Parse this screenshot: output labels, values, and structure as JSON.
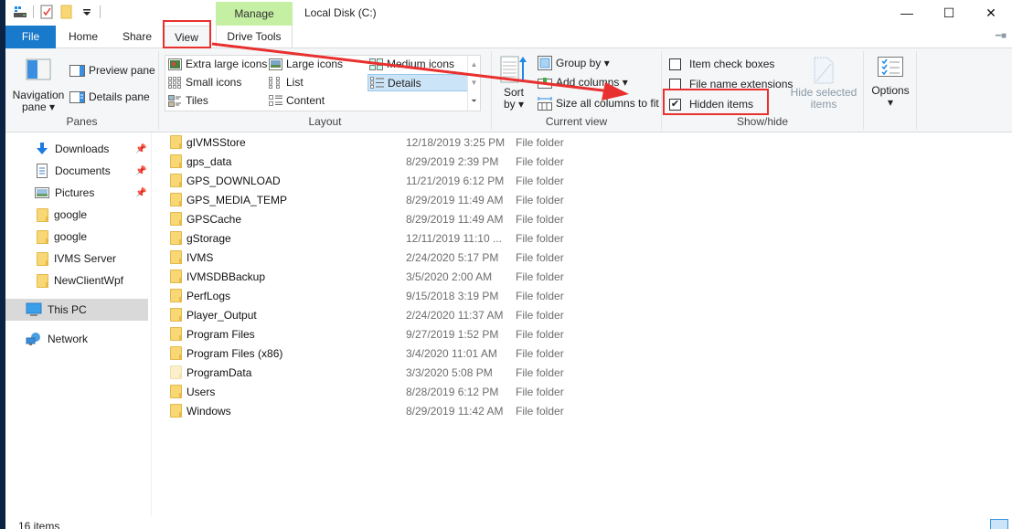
{
  "window": {
    "title": "Local Disk (C:)",
    "context_tab": "Manage",
    "minimize": "—",
    "maximize": "☐",
    "close": "✕"
  },
  "tabs": {
    "file": "File",
    "home": "Home",
    "share": "Share",
    "view": "View",
    "drive_tools": "Drive Tools"
  },
  "ribbon": {
    "panes": {
      "label": "Panes",
      "navigation_pane": "Navigation",
      "navigation_pane_2": "pane ▾",
      "preview_pane": "Preview pane",
      "details_pane": "Details pane"
    },
    "layout": {
      "label": "Layout",
      "items": [
        "Extra large icons",
        "Large icons",
        "Medium icons",
        "Small icons",
        "List",
        "Details",
        "Tiles",
        "Content"
      ],
      "selected": "Details"
    },
    "current_view": {
      "label": "Current view",
      "sort_by": "Sort",
      "sort_by_2": "by ▾",
      "group_by": "Group by ▾",
      "add_columns": "Add columns ▾",
      "size_columns": "Size all columns to fit"
    },
    "show_hide": {
      "label": "Show/hide",
      "item_check_boxes": "Item check boxes",
      "item_check_boxes_checked": false,
      "file_name_extensions": "File name extensions",
      "file_name_extensions_checked": false,
      "hidden_items": "Hidden items",
      "hidden_items_checked": true,
      "hide_selected": "Hide selected",
      "hide_selected_2": "items"
    },
    "options": {
      "label": "Options",
      "caret": "▾"
    }
  },
  "nav": {
    "items": [
      {
        "label": "Downloads",
        "icon": "download-icon",
        "pinned": true
      },
      {
        "label": "Documents",
        "icon": "documents-icon",
        "pinned": true
      },
      {
        "label": "Pictures",
        "icon": "pictures-icon",
        "pinned": true
      },
      {
        "label": "google",
        "icon": "folder-icon",
        "pinned": false
      },
      {
        "label": "google",
        "icon": "folder-icon",
        "pinned": false
      },
      {
        "label": "IVMS Server",
        "icon": "folder-icon",
        "pinned": false
      },
      {
        "label": "NewClientWpf",
        "icon": "folder-icon",
        "pinned": false
      },
      {
        "label": "This PC",
        "icon": "computer-icon",
        "pinned": false,
        "selected": true
      },
      {
        "label": "Network",
        "icon": "network-icon",
        "pinned": false
      }
    ]
  },
  "files": [
    {
      "name": "gIVMSStore",
      "date": "12/18/2019 3:25 PM",
      "type": "File folder"
    },
    {
      "name": "gps_data",
      "date": "8/29/2019 2:39 PM",
      "type": "File folder"
    },
    {
      "name": "GPS_DOWNLOAD",
      "date": "11/21/2019 6:12 PM",
      "type": "File folder"
    },
    {
      "name": "GPS_MEDIA_TEMP",
      "date": "8/29/2019 11:49 AM",
      "type": "File folder"
    },
    {
      "name": "GPSCache",
      "date": "8/29/2019 11:49 AM",
      "type": "File folder"
    },
    {
      "name": "gStorage",
      "date": "12/11/2019 11:10 ...",
      "type": "File folder"
    },
    {
      "name": "IVMS",
      "date": "2/24/2020 5:17 PM",
      "type": "File folder"
    },
    {
      "name": "IVMSDBBackup",
      "date": "3/5/2020 2:00 AM",
      "type": "File folder"
    },
    {
      "name": "PerfLogs",
      "date": "9/15/2018 3:19 PM",
      "type": "File folder"
    },
    {
      "name": "Player_Output",
      "date": "2/24/2020 11:37 AM",
      "type": "File folder"
    },
    {
      "name": "Program Files",
      "date": "9/27/2019 1:52 PM",
      "type": "File folder"
    },
    {
      "name": "Program Files (x86)",
      "date": "3/4/2020 11:01 AM",
      "type": "File folder"
    },
    {
      "name": "ProgramData",
      "date": "3/3/2020 5:08 PM",
      "type": "File folder",
      "hidden": true
    },
    {
      "name": "Users",
      "date": "8/28/2019 6:12 PM",
      "type": "File folder"
    },
    {
      "name": "Windows",
      "date": "8/29/2019 11:42 AM",
      "type": "File folder"
    }
  ],
  "status": {
    "item_count": "16 items"
  },
  "colors": {
    "accent": "#1979ca",
    "manage_tab": "#c5efa3",
    "annotation": "#e8302e",
    "selection": "#cce4f7"
  }
}
